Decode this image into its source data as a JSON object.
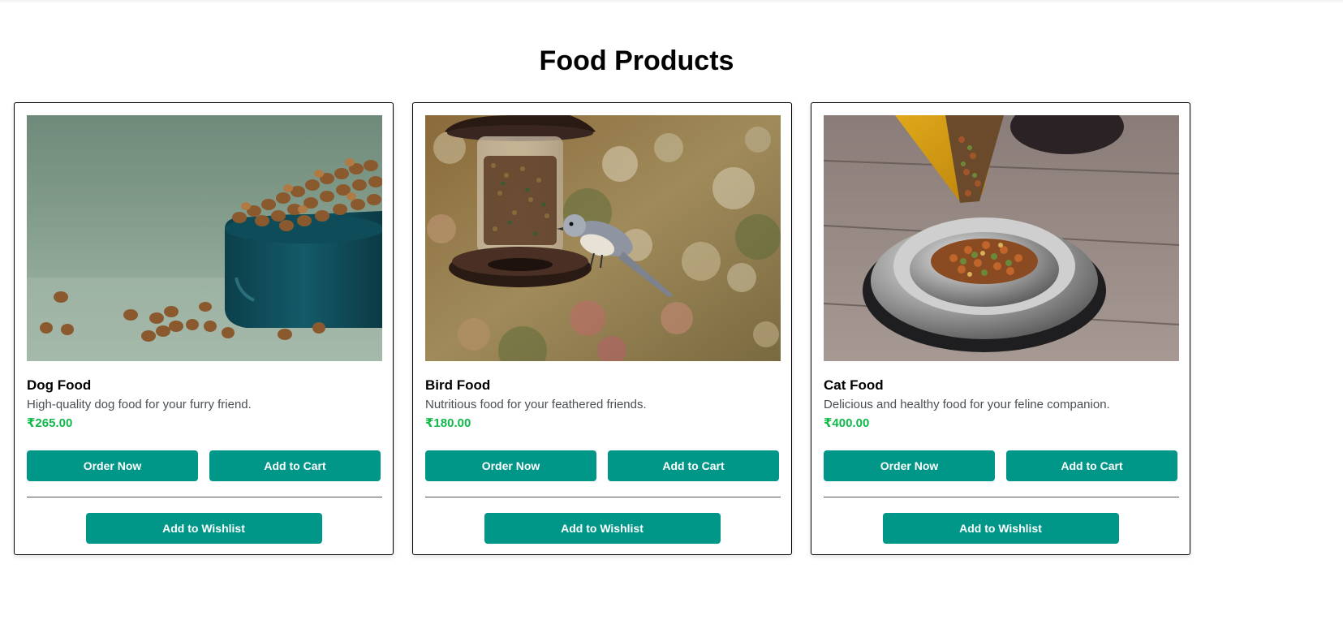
{
  "page": {
    "title": "Food Products"
  },
  "products": [
    {
      "name": "Dog Food",
      "description": "High-quality dog food for your furry friend.",
      "price": "₹265.00",
      "image": "dog-food-bowl-image",
      "order_label": "Order Now",
      "cart_label": "Add to Cart",
      "wishlist_label": "Add to Wishlist"
    },
    {
      "name": "Bird Food",
      "description": "Nutritious food for your feathered friends.",
      "price": "₹180.00",
      "image": "bird-feeder-image",
      "order_label": "Order Now",
      "cart_label": "Add to Cart",
      "wishlist_label": "Add to Wishlist"
    },
    {
      "name": "Cat Food",
      "description": "Delicious and healthy food for your feline companion.",
      "price": "₹400.00",
      "image": "cat-food-bowl-image",
      "order_label": "Order Now",
      "cart_label": "Add to Cart",
      "wishlist_label": "Add to Wishlist"
    }
  ],
  "colors": {
    "button": "#009688",
    "price": "#10b84a",
    "description": "#4a4f55"
  }
}
